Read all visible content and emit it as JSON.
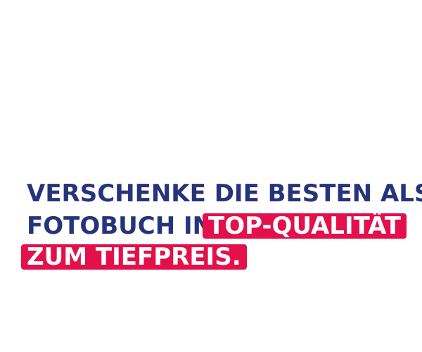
{
  "headline": {
    "line1": "VERSCHENKE DIE BESTEN ALS",
    "line2_prefix": "FOTOBUCH IN",
    "highlight1": "TOP-QUALITÄT",
    "highlight2": "ZUM TIEFPREIS."
  },
  "colors": {
    "primary_text": "#27337a",
    "highlight_background": "#e3104b",
    "highlight_text": "#ffffff",
    "background": "#ffffff"
  }
}
